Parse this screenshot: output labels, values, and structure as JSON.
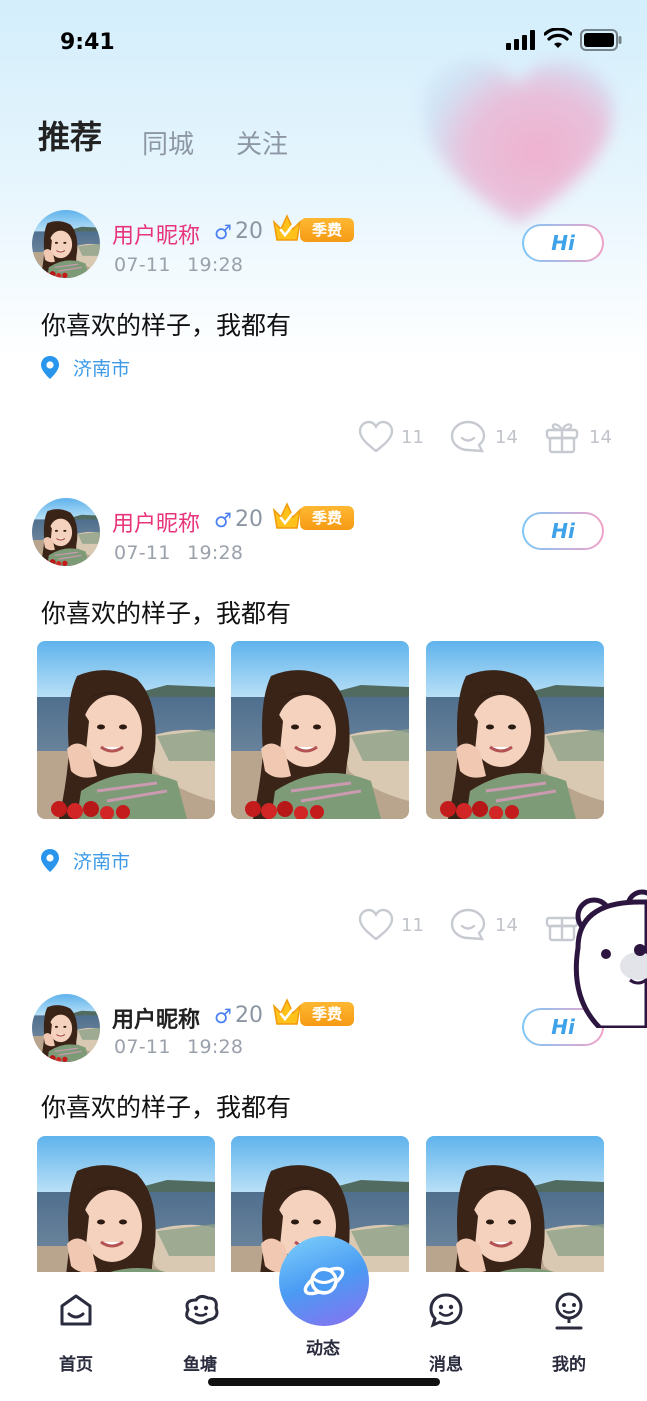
{
  "status_bar": {
    "time": "9:41"
  },
  "tabs": [
    {
      "label": "推荐",
      "active": true
    },
    {
      "label": "同城",
      "active": false
    },
    {
      "label": "关注",
      "active": false
    }
  ],
  "posts": [
    {
      "nickname": "用户昵称",
      "gender": "♂",
      "age": "20",
      "vip_label": "季费",
      "date": "07-11",
      "time": "19:28",
      "hi_label": "Hi",
      "content": "你喜欢的样子，我都有",
      "location": "济南市",
      "likes": "11",
      "comments": "14",
      "gifts": "14"
    },
    {
      "nickname": "用户昵称",
      "gender": "♂",
      "age": "20",
      "vip_label": "季费",
      "date": "07-11",
      "time": "19:28",
      "hi_label": "Hi",
      "content": "你喜欢的样子，我都有",
      "location": "济南市",
      "likes": "11",
      "comments": "14"
    },
    {
      "nickname": "用户昵称",
      "gender": "♂",
      "age": "20",
      "vip_label": "季费",
      "date": "07-11",
      "time": "19:28",
      "hi_label": "Hi",
      "content": "你喜欢的样子，我都有"
    }
  ],
  "nav": {
    "items": [
      {
        "label": "首页",
        "icon": "home-icon"
      },
      {
        "label": "鱼塘",
        "icon": "pond-icon"
      },
      {
        "label": "动态",
        "icon": "planet-icon"
      },
      {
        "label": "消息",
        "icon": "message-icon"
      },
      {
        "label": "我的",
        "icon": "profile-icon"
      }
    ]
  },
  "colors": {
    "accent_blue": "#3d9be9",
    "nickname_pink": "#e8347a",
    "vip_orange": "#f59a14",
    "nav_center": "#4a9bf3"
  }
}
